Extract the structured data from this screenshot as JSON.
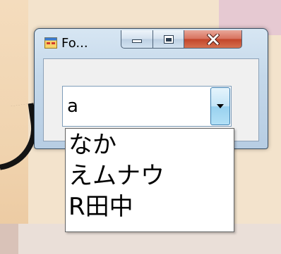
{
  "window": {
    "title": "Fo...",
    "icons": {
      "app": "app-window-icon",
      "minimize": "minimize-icon",
      "maximize": "maximize-icon",
      "close": "close-icon"
    }
  },
  "combobox": {
    "value": "a",
    "arrow_icon": "dropdown-arrow-icon",
    "options": [
      "なか",
      "えムナウ",
      "R田中"
    ]
  },
  "colors": {
    "close_button": "#c2452a",
    "arrow_button": "#98d1ef",
    "title_bar": "#c4d8ea"
  }
}
